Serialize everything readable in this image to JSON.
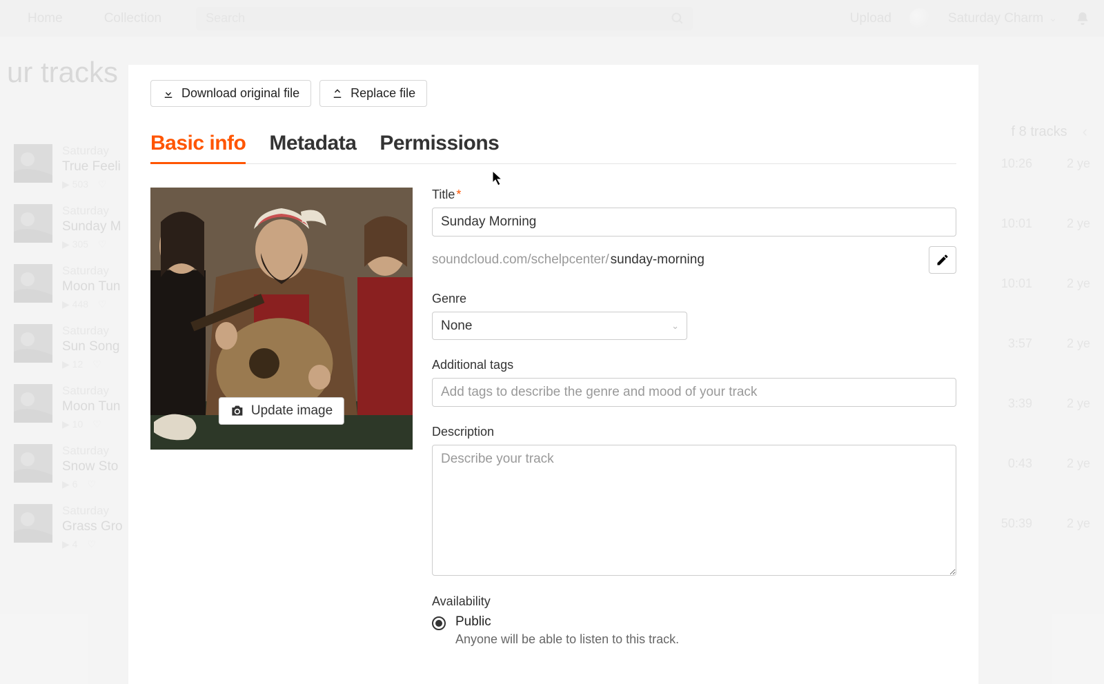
{
  "topbar": {
    "home": "Home",
    "collection": "Collection",
    "search_placeholder": "Search",
    "upload": "Upload",
    "username": "Saturday Charm"
  },
  "bg": {
    "page_title": "ur tracks",
    "track_count": "f 8 tracks",
    "tracks": [
      {
        "artist": "Saturday",
        "title": "True Feeli",
        "plays": "503",
        "dur": "10:26",
        "age": "2 ye"
      },
      {
        "artist": "Saturday",
        "title": "Sunday M",
        "plays": "305",
        "dur": "10:01",
        "age": "2 ye"
      },
      {
        "artist": "Saturday",
        "title": "Moon Tun",
        "plays": "448",
        "dur": "10:01",
        "age": "2 ye"
      },
      {
        "artist": "Saturday",
        "title": "Sun Song",
        "plays": "12",
        "dur": "3:57",
        "age": "2 ye"
      },
      {
        "artist": "Saturday",
        "title": "Moon Tun",
        "plays": "10",
        "dur": "3:39",
        "age": "2 ye"
      },
      {
        "artist": "Saturday",
        "title": "Snow Sto",
        "plays": "6",
        "dur": "0:43",
        "age": "2 ye"
      },
      {
        "artist": "Saturday",
        "title": "Grass Gro",
        "plays": "4",
        "dur": "50:39",
        "age": "2 ye"
      }
    ]
  },
  "modal": {
    "download_btn": "Download original file",
    "replace_btn": "Replace file",
    "tabs": {
      "basic": "Basic info",
      "metadata": "Metadata",
      "permissions": "Permissions"
    },
    "update_image_btn": "Update image",
    "title_label": "Title",
    "title_value": "Sunday Morning",
    "permalink_prefix": "soundcloud.com/schelpcenter/",
    "permalink_slug": "sunday-morning",
    "genre_label": "Genre",
    "genre_value": "None",
    "tags_label": "Additional tags",
    "tags_placeholder": "Add tags to describe the genre and mood of your track",
    "desc_label": "Description",
    "desc_placeholder": "Describe your track",
    "avail_label": "Availability",
    "avail_public_label": "Public",
    "avail_public_desc": "Anyone will be able to listen to this track."
  }
}
